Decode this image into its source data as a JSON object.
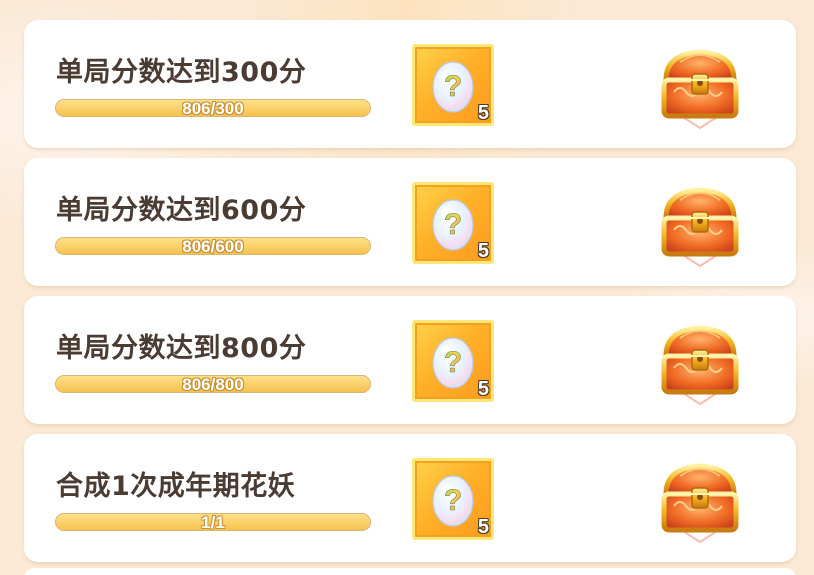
{
  "tasks": [
    {
      "title": "单局分数达到300分",
      "progress_text": "806/300",
      "progress_fraction": 1.0,
      "reward_icon": "mystery-egg-icon",
      "reward_count": "5",
      "chest_icon": "treasure-chest-icon"
    },
    {
      "title": "单局分数达到600分",
      "progress_text": "806/600",
      "progress_fraction": 1.0,
      "reward_icon": "mystery-egg-icon",
      "reward_count": "5",
      "chest_icon": "treasure-chest-icon"
    },
    {
      "title": "单局分数达到800分",
      "progress_text": "806/800",
      "progress_fraction": 1.0,
      "reward_icon": "mystery-egg-icon",
      "reward_count": "5",
      "chest_icon": "treasure-chest-icon"
    },
    {
      "title": "合成1次成年期花妖",
      "progress_text": "1/1",
      "progress_fraction": 1.0,
      "reward_icon": "mystery-egg-icon",
      "reward_count": "5",
      "chest_icon": "treasure-chest-icon"
    }
  ],
  "colors": {
    "background": "#fbe9d5",
    "card": "#ffffff",
    "title_text": "#4a3b33",
    "progress_fill": "#f5c14d",
    "reward_slot": "#ffb12a",
    "chest_gold": "#f3b321"
  }
}
